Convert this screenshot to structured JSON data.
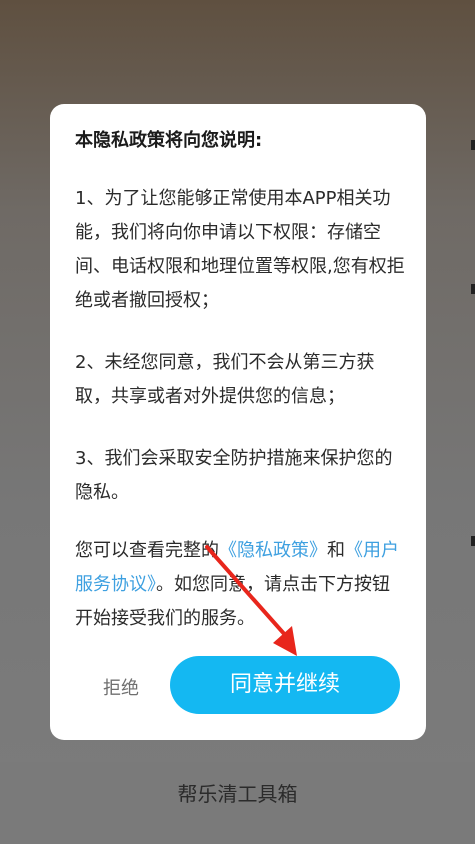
{
  "dialog": {
    "title": "本隐私政策将向您说明:",
    "item1": "1、为了让您能够正常使用本APP相关功能，我们将向你申请以下权限：存储空间、电话权限和地理位置等权限,您有权拒绝或者撤回授权；",
    "item2": "2、未经您同意，我们不会从第三方获取，共享或者对外提供您的信息；",
    "item3": "3、我们会采取安全防护措施来保护您的隐私。",
    "notice_prefix": "您可以查看完整的",
    "privacy_link": "《隐私政策》",
    "notice_and": "和",
    "agreement_link": "《用户服务协议》",
    "notice_suffix": "。如您同意，请点击下方按钮开始接受我们的服务。",
    "reject_label": "拒绝",
    "agree_label": "同意并继续"
  },
  "app_name": "帮乐清工具箱",
  "colors": {
    "accent": "#14b8f2",
    "link": "#3ea0e0",
    "annotation_arrow": "#e8261c"
  }
}
